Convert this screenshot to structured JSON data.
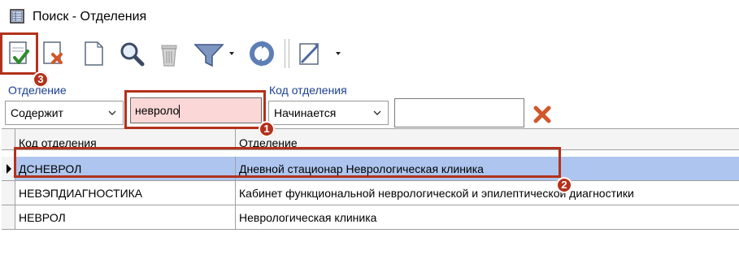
{
  "window": {
    "title": "Поиск - Отделения"
  },
  "toolbar": {
    "buttons": [
      {
        "name": "select-confirm-icon"
      },
      {
        "name": "delete-icon"
      },
      {
        "name": "new-document-icon"
      },
      {
        "name": "search-icon"
      },
      {
        "name": "trash-icon"
      },
      {
        "name": "filter-icon"
      },
      {
        "name": "refresh-icon"
      },
      {
        "name": "edit-icon"
      }
    ]
  },
  "filters": {
    "field1_label": "Отделение",
    "field1_mode": "Содержит",
    "field1_value": "невроло",
    "field2_label": "Код отделения",
    "field2_mode": "Начинается",
    "field2_value": ""
  },
  "grid": {
    "columns": [
      "Код отделения",
      "Отделение"
    ],
    "rows": [
      {
        "code": "ДСНЕВРОЛ",
        "name": "Дневной стационар Неврологическая клиника",
        "selected": true
      },
      {
        "code": "НЕВЭПДИАГНОСТИКА",
        "name": "Кабинет функциональной неврологической и эпилептической диагностики",
        "selected": false
      },
      {
        "code": "НЕВРОЛ",
        "name": "Неврологическая клиника",
        "selected": false
      }
    ]
  },
  "annotations": {
    "badge1": "1",
    "badge2": "2",
    "badge3": "3"
  },
  "colors": {
    "accent": "#b2321c",
    "selected_row": "#aec6ef",
    "input_highlight": "#fcd7d7",
    "label_blue": "#1b3f94"
  }
}
